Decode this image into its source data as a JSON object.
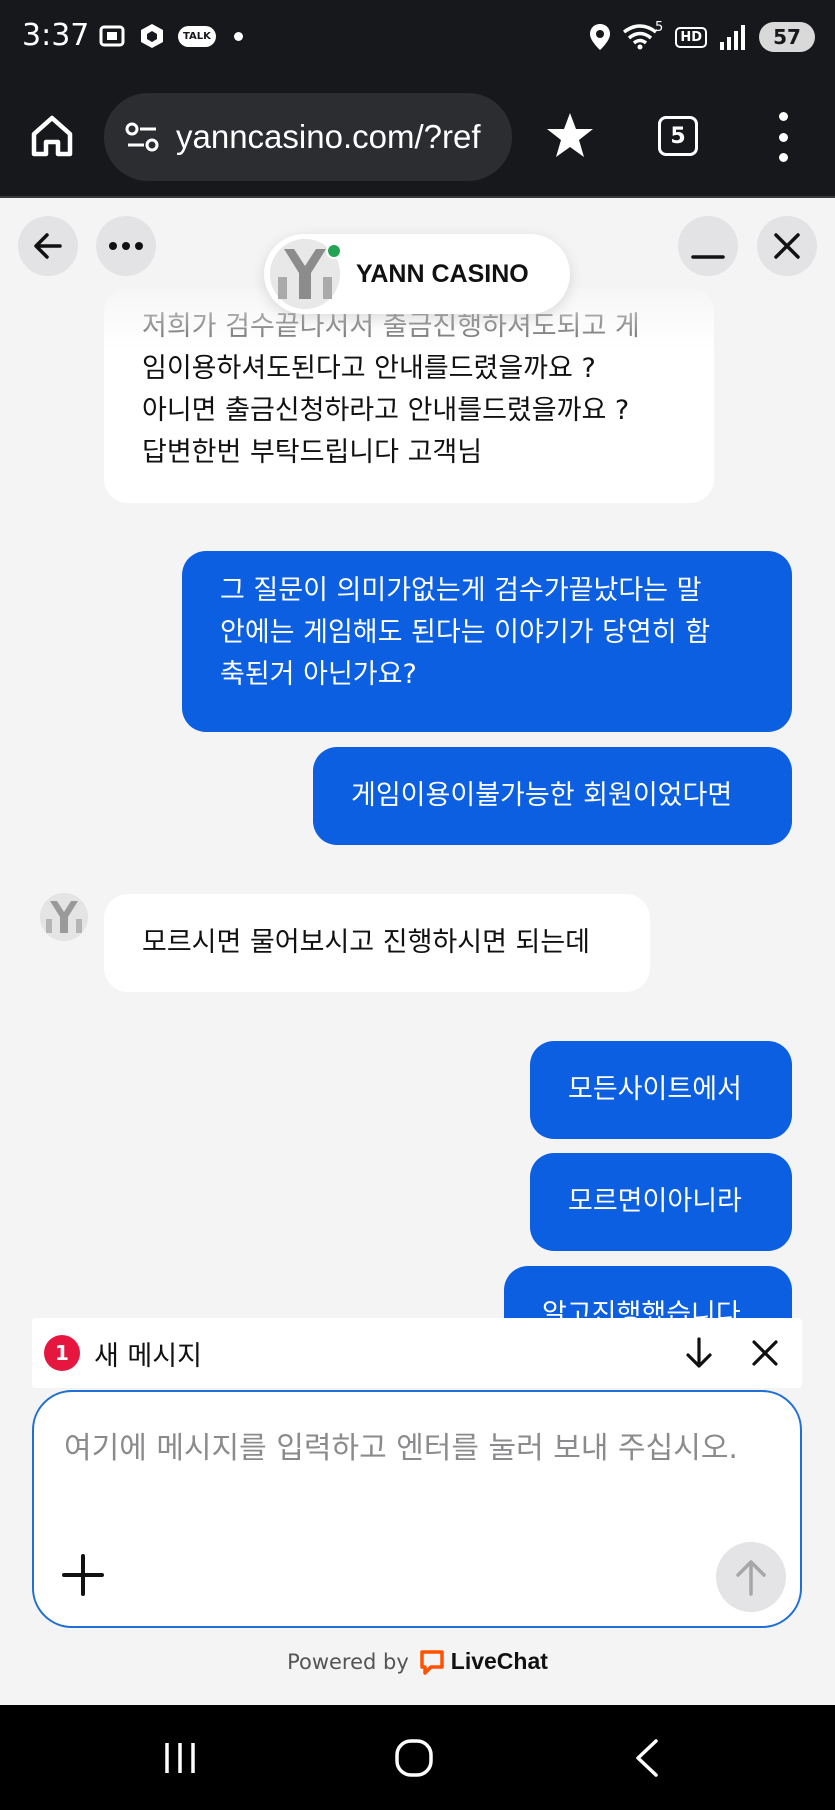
{
  "status_bar": {
    "time": "3:37",
    "talk_label": "TALK",
    "network_label": "5",
    "hd_label": "HD",
    "battery": "57"
  },
  "browser": {
    "url": "yanncasino.com/?ref",
    "tab_count": "5"
  },
  "chat_header": {
    "title": "YANN CASINO"
  },
  "messages": [
    {
      "sender": "agent",
      "lines": [
        "저희가 검수끝나서서 출금진행하셔도되고 게",
        "임이용하셔도된다고 안내를드렸을까요 ?",
        "아니면 출금신청하라고 안내를드렸을까요 ?",
        "답변한번 부탁드립니다 고객님"
      ]
    },
    {
      "sender": "visitor",
      "lines": [
        "그 질문이 의미가없는게 검수가끝났다는 말",
        "안에는 게임해도 된다는 이야기가 당연히 함",
        "축된거 아닌가요?"
      ]
    },
    {
      "sender": "visitor",
      "lines": [
        "게임이용이불가능한 회원이었다면"
      ]
    },
    {
      "sender": "agent",
      "lines": [
        "모르시면 물어보시고 진행하시면 되는데"
      ]
    },
    {
      "sender": "visitor",
      "lines": [
        "모든사이트에서"
      ]
    },
    {
      "sender": "visitor",
      "lines": [
        "모르면이아니라"
      ]
    },
    {
      "sender": "visitor",
      "lines": [
        "알고진행했습니다"
      ]
    }
  ],
  "new_message_bar": {
    "count": "1",
    "label": "새 메시지"
  },
  "composer": {
    "placeholder": "여기에 메시지를 입력하고 엔터를 눌러 보내 주십시오."
  },
  "footer": {
    "powered_by": "Powered by",
    "brand": "LiveChat"
  },
  "colors": {
    "visitor_bubble": "#0b5fe0",
    "agent_bubble": "#ffffff",
    "badge": "#e5173f",
    "livechat_brand": "#ff5100",
    "online_dot": "#23a455"
  },
  "icons": [
    "home-icon",
    "site-settings-icon",
    "star-icon",
    "tabs-icon",
    "more-vert-icon",
    "back-arrow-icon",
    "more-horiz-icon",
    "minimize-icon",
    "close-icon",
    "arrow-down-icon",
    "plus-icon",
    "send-arrow-icon",
    "recents-icon",
    "home-circle-icon",
    "back-chevron-icon"
  ]
}
